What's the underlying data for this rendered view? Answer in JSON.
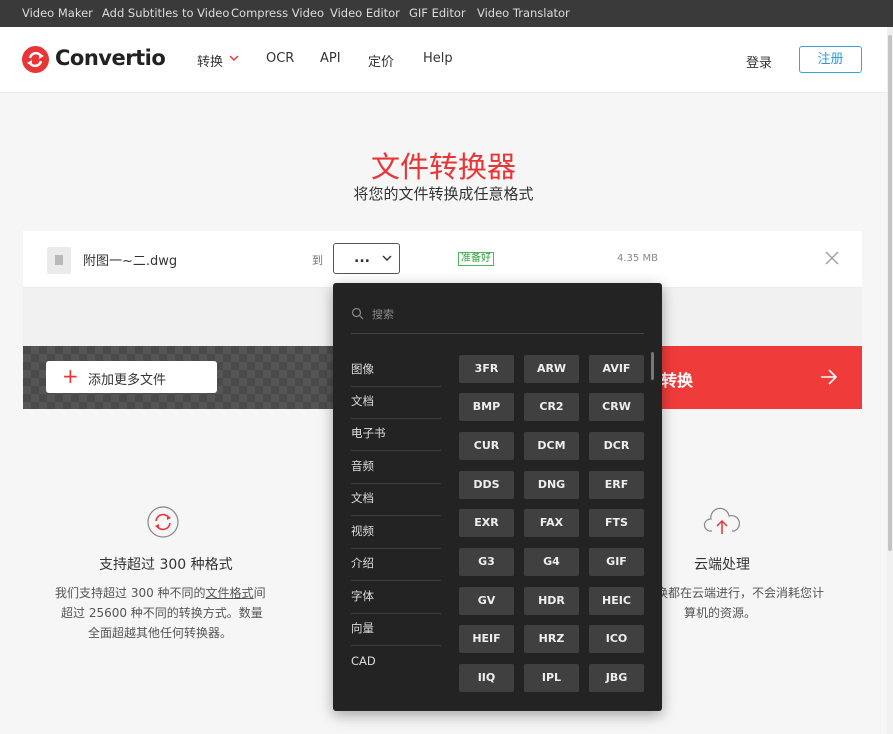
{
  "topbar": {
    "links": [
      "Video Maker",
      "Add Subtitles to Video",
      "Compress Video",
      "Video Editor",
      "GIF Editor",
      "Video Translator"
    ]
  },
  "header": {
    "brand": "Convertio",
    "nav": [
      "转换",
      "OCR",
      "API",
      "定价",
      "Help"
    ],
    "login": "登录",
    "register": "注册",
    "accent_color": "#e93535"
  },
  "hero": {
    "title": "文件转换器",
    "subtitle": "将您的文件转换成任意格式"
  },
  "file": {
    "name": "附图一~二.dwg",
    "to_label": "到",
    "format_placeholder": "...",
    "status": "准备好",
    "size": "4.35 MB"
  },
  "actions": {
    "add_more": "添加更多文件",
    "convert": "转换"
  },
  "features": {
    "left": {
      "title": "支持超过 300 种格式",
      "desc_line1_pre": "我们支持超过 300 种不同的",
      "desc_line1_link": "文件格式",
      "desc_line1_post": "间",
      "desc_line2": "超过 25600 种不同的转换方式。数量",
      "desc_line3": "全面超越其他任何转换器。"
    },
    "right": {
      "title": "云端处理",
      "desc_line1": "换都在云端进行，不会消耗您计",
      "desc_line2": "算机的资源。"
    }
  },
  "dropdown": {
    "search_placeholder": "搜索",
    "categories": [
      "图像",
      "文档",
      "电子书",
      "音频",
      "文档",
      "视频",
      "介绍",
      "字体",
      "向量",
      "CAD"
    ],
    "formats": [
      "3FR",
      "ARW",
      "AVIF",
      "BMP",
      "CR2",
      "CRW",
      "CUR",
      "DCM",
      "DCR",
      "DDS",
      "DNG",
      "ERF",
      "EXR",
      "FAX",
      "FTS",
      "G3",
      "G4",
      "GIF",
      "GV",
      "HDR",
      "HEIC",
      "HEIF",
      "HRZ",
      "ICO",
      "IIQ",
      "IPL",
      "JBG"
    ]
  }
}
